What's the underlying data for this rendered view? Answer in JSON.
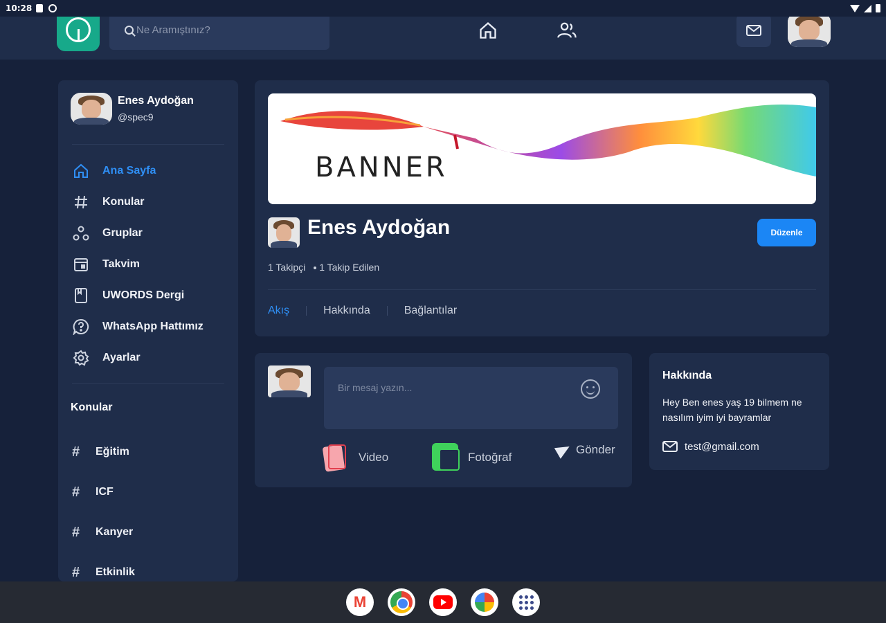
{
  "status_bar": {
    "time": "10:28"
  },
  "search": {
    "placeholder": "Ne Aramıştınız?"
  },
  "user": {
    "name": "Enes Aydoğan",
    "handle": "@spec9"
  },
  "menu": [
    {
      "label": "Ana Sayfa",
      "icon": "home-icon",
      "active": true
    },
    {
      "label": "Konular",
      "icon": "hash-icon"
    },
    {
      "label": "Gruplar",
      "icon": "groups-icon"
    },
    {
      "label": "Takvim",
      "icon": "calendar-icon"
    },
    {
      "label": "UWORDS Dergi",
      "icon": "book-icon"
    },
    {
      "label": "WhatsApp Hattımız",
      "icon": "help-icon"
    },
    {
      "label": "Ayarlar",
      "icon": "gear-icon"
    }
  ],
  "topics": {
    "title": "Konular",
    "items": [
      "Eğitim",
      "ICF",
      "Kanyer",
      "Etkinlik"
    ]
  },
  "profile": {
    "banner_text": "BANNER",
    "name": "Enes Aydoğan",
    "edit_label": "Düzenle",
    "followers": "1 Takipçi",
    "following": "1 Takip Edilen",
    "tabs": [
      "Akış",
      "Hakkında",
      "Bağlantılar"
    ]
  },
  "composer": {
    "placeholder": "Bir mesaj yazın...",
    "video_label": "Video",
    "photo_label": "Fotoğraf",
    "send_label": "Gönder"
  },
  "about": {
    "title": "Hakkında",
    "bio": "Hey Ben enes yaş 19 bilmem ne nasılım iyim iyi bayramlar",
    "email": "test@gmail.com"
  },
  "colors": {
    "accent": "#2f8ff5",
    "card": "#1f2d4a",
    "background": "#16213a",
    "logo": "#17a98a"
  }
}
